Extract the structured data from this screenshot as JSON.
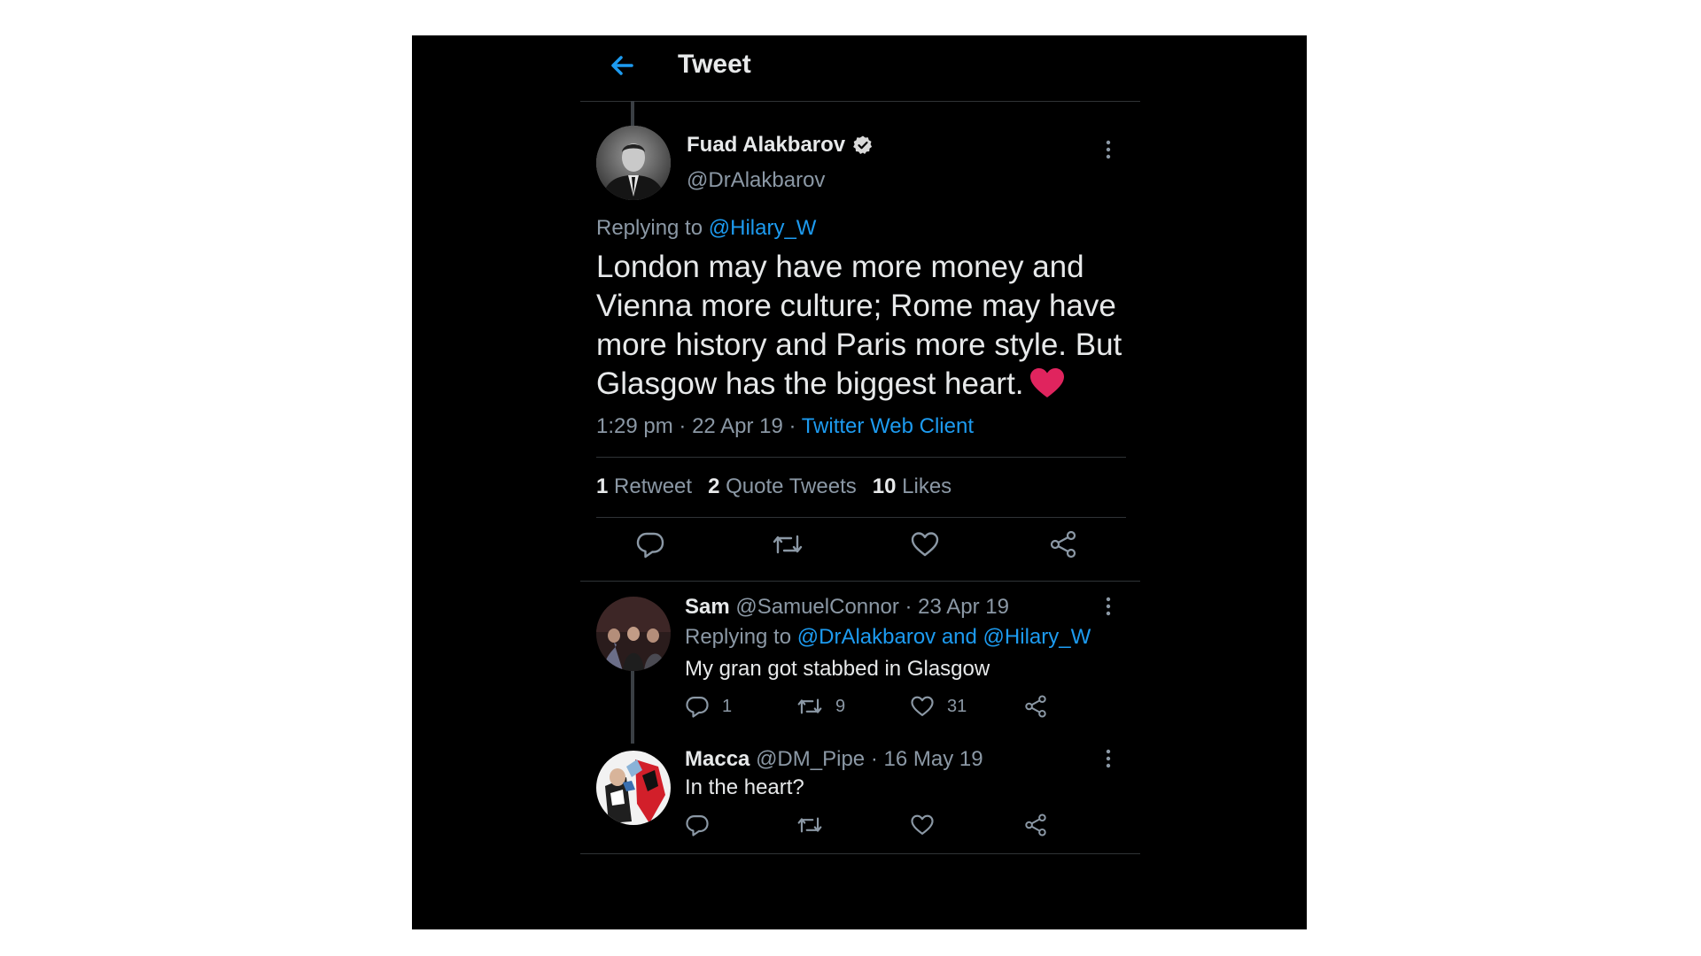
{
  "header": {
    "title": "Tweet"
  },
  "main_tweet": {
    "display_name": "Fuad Alakbarov",
    "handle": "@DrAlakbarov",
    "replying_label": "Replying to",
    "replying_to": "@Hilary_W",
    "text": "London may have more money and Vienna more culture; Rome may have more history and Paris more style. But Glasgow has the biggest heart.",
    "time": "1:29 pm",
    "sep": "·",
    "date": "22 Apr 19",
    "client": "Twitter Web Client",
    "stats": {
      "retweets": "1",
      "retweets_label": "Retweet",
      "quotes": "2",
      "quotes_label": "Quote Tweets",
      "likes": "10",
      "likes_label": "Likes"
    }
  },
  "replies": [
    {
      "display_name": "Sam",
      "handle": "@SamuelConnor",
      "sep": "·",
      "date": "23 Apr 19",
      "replying_label": "Replying to",
      "replying_to": "@DrAlakbarov and @Hilary_W",
      "text": "My gran got stabbed in Glasgow",
      "reply_count": "1",
      "retweet_count": "9",
      "like_count": "31"
    },
    {
      "display_name": "Macca",
      "handle": "@DM_Pipe",
      "sep": "·",
      "date": "16 May 19",
      "text": "In the heart?"
    }
  ],
  "colors": {
    "background": "#000000",
    "text": "#e7e9ea",
    "secondary": "#8b98a5",
    "link": "#1d9bf0",
    "heart_emoji": "#e0245e"
  },
  "icons": [
    "back-arrow-icon",
    "verified-badge-icon",
    "more-options-icon",
    "reply-icon",
    "retweet-icon",
    "like-icon",
    "share-icon",
    "red-heart-emoji"
  ]
}
